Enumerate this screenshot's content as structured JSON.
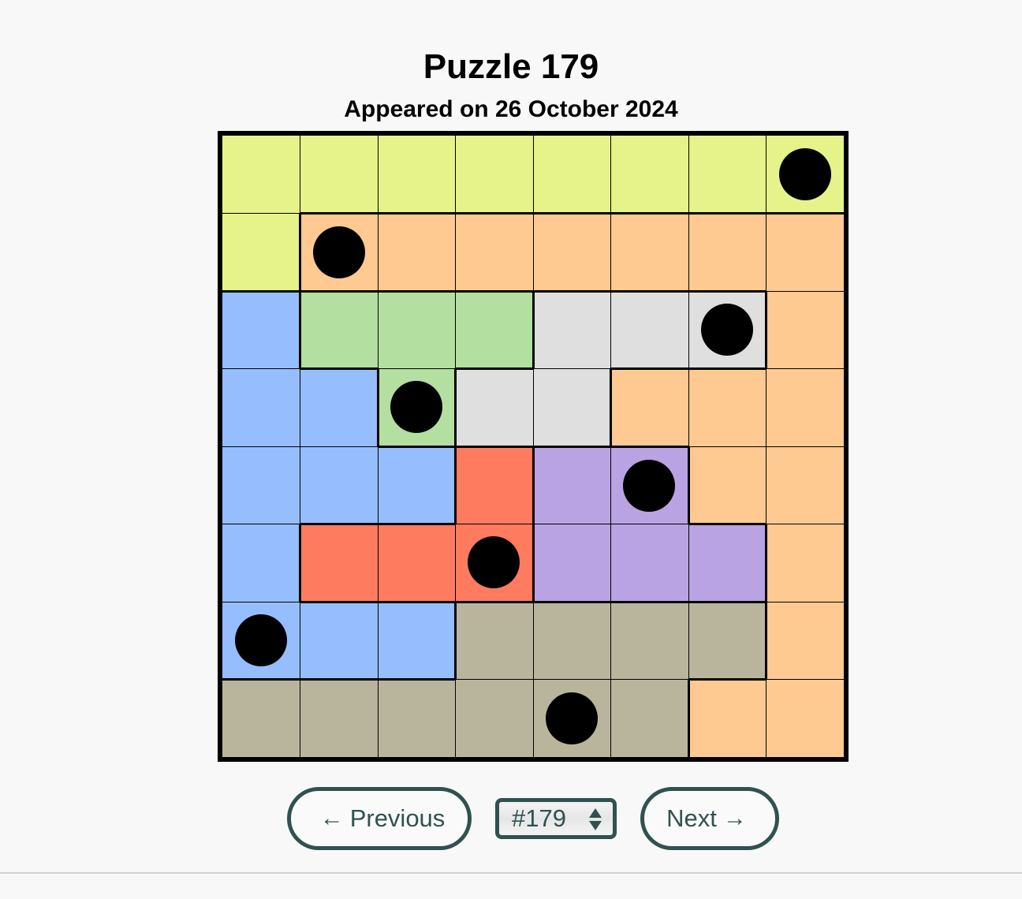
{
  "header": {
    "title": "Puzzle 179",
    "subtitle": "Appeared on 26 October 2024"
  },
  "colors": {
    "Y": "#E5F38A",
    "O": "#FFC992",
    "B": "#96BEFF",
    "G": "#B3DFA0",
    "W": "#DFDFDF",
    "R": "#FF7B60",
    "P": "#B9A3E3",
    "T": "#B9B59D"
  },
  "region_names": {
    "Y": "yellow",
    "O": "orange",
    "B": "blue",
    "G": "green",
    "W": "gray",
    "R": "red",
    "P": "purple",
    "T": "taupe"
  },
  "grid": {
    "rows": 8,
    "cols": 8,
    "regions": [
      [
        "Y",
        "Y",
        "Y",
        "Y",
        "Y",
        "Y",
        "Y",
        "Y"
      ],
      [
        "Y",
        "O",
        "O",
        "O",
        "O",
        "O",
        "O",
        "O"
      ],
      [
        "B",
        "G",
        "G",
        "G",
        "W",
        "W",
        "W",
        "O"
      ],
      [
        "B",
        "B",
        "G",
        "W",
        "W",
        "O",
        "O",
        "O"
      ],
      [
        "B",
        "B",
        "B",
        "R",
        "P",
        "P",
        "O",
        "O"
      ],
      [
        "B",
        "R",
        "R",
        "R",
        "P",
        "P",
        "P",
        "O"
      ],
      [
        "B",
        "B",
        "B",
        "T",
        "T",
        "T",
        "T",
        "O"
      ],
      [
        "T",
        "T",
        "T",
        "T",
        "T",
        "T",
        "O",
        "O"
      ]
    ],
    "queens": [
      [
        0,
        7
      ],
      [
        1,
        1
      ],
      [
        2,
        6
      ],
      [
        3,
        2
      ],
      [
        4,
        5
      ],
      [
        5,
        3
      ],
      [
        6,
        0
      ],
      [
        7,
        4
      ]
    ]
  },
  "navigation": {
    "previous_label": "Previous",
    "previous_arrow": "←",
    "next_label": "Next",
    "next_arrow": "→",
    "puzzle_select_value": "#179"
  }
}
